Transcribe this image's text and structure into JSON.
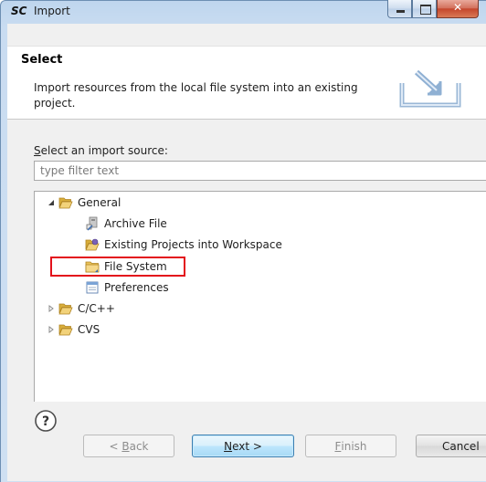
{
  "window": {
    "app_logo": "SC",
    "title": "Import"
  },
  "header": {
    "heading": "Select",
    "description": "Import resources from the local file system into an existing project."
  },
  "source": {
    "label_prefix": "",
    "label_accel": "S",
    "label_rest": "elect an import source:",
    "filter_placeholder": "type filter text"
  },
  "tree": {
    "general": {
      "label": "General",
      "expanded": true
    },
    "archive_file": {
      "label": "Archive File"
    },
    "existing_projects": {
      "label": "Existing Projects into Workspace"
    },
    "file_system": {
      "label": "File System",
      "highlighted": true
    },
    "preferences": {
      "label": "Preferences"
    },
    "cpp": {
      "label": "C/C++",
      "expanded": false
    },
    "cvs": {
      "label": "CVS",
      "expanded": false
    }
  },
  "buttons": {
    "back_lt": "< ",
    "back_accel": "B",
    "back_rest": "ack",
    "next_accel": "N",
    "next_rest": "ext >",
    "finish_accel": "F",
    "finish_rest": "inish",
    "cancel": "Cancel"
  },
  "colors": {
    "highlight_border": "#e3111b",
    "folder": "#e9c35a",
    "default_button_border": "#3c7fb1"
  }
}
